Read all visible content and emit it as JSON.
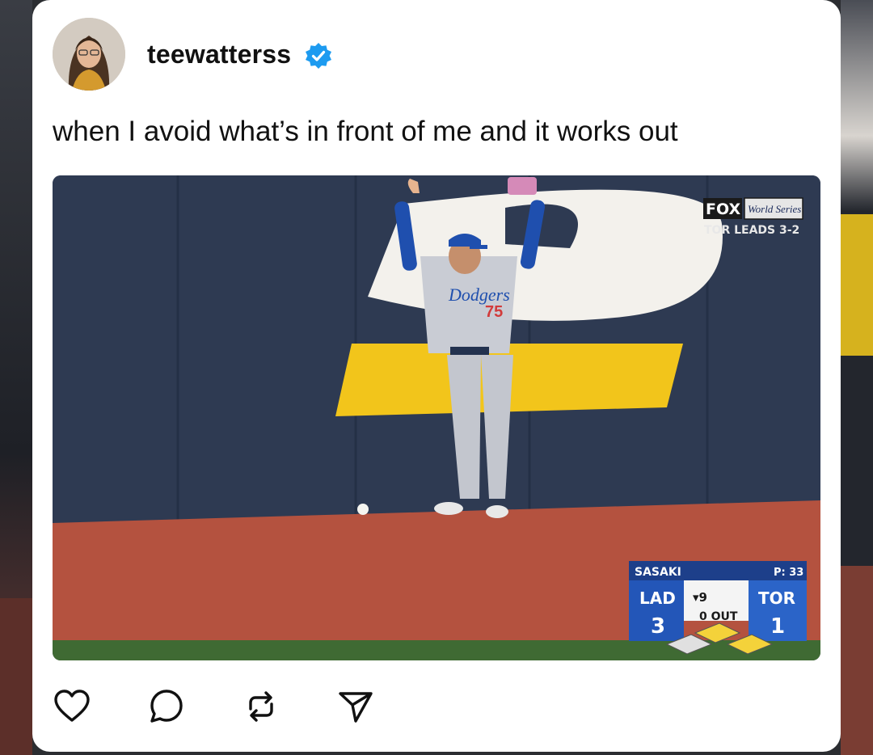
{
  "post": {
    "username": "teewatterss",
    "verified": true,
    "caption": "when I avoid what’s in front of me and it works out"
  },
  "media": {
    "network_logo": "FOX",
    "event_logo": "World Series",
    "series_status": "TOR LEADS 3-2",
    "scorebug": {
      "pitcher": "SASAKI",
      "pitch_count": "P: 33",
      "away_team": "LAD",
      "away_score": "3",
      "inning": "▾9",
      "outs": "0 OUT",
      "home_team": "TOR",
      "home_score": "1"
    },
    "jersey_text": "Dodgers",
    "jersey_number": "75"
  },
  "actions": [
    {
      "name": "like",
      "icon": "heart-icon"
    },
    {
      "name": "comment",
      "icon": "comment-bubble-icon"
    },
    {
      "name": "repost",
      "icon": "repost-icon"
    },
    {
      "name": "share",
      "icon": "send-icon"
    }
  ],
  "colors": {
    "verified_blue": "#1d9bf0",
    "wall_navy": "#2e3a52",
    "warning_track": "#b4523f",
    "wall_yellow": "#f2c51b",
    "scorebug_blue": "#1d3f8a"
  }
}
